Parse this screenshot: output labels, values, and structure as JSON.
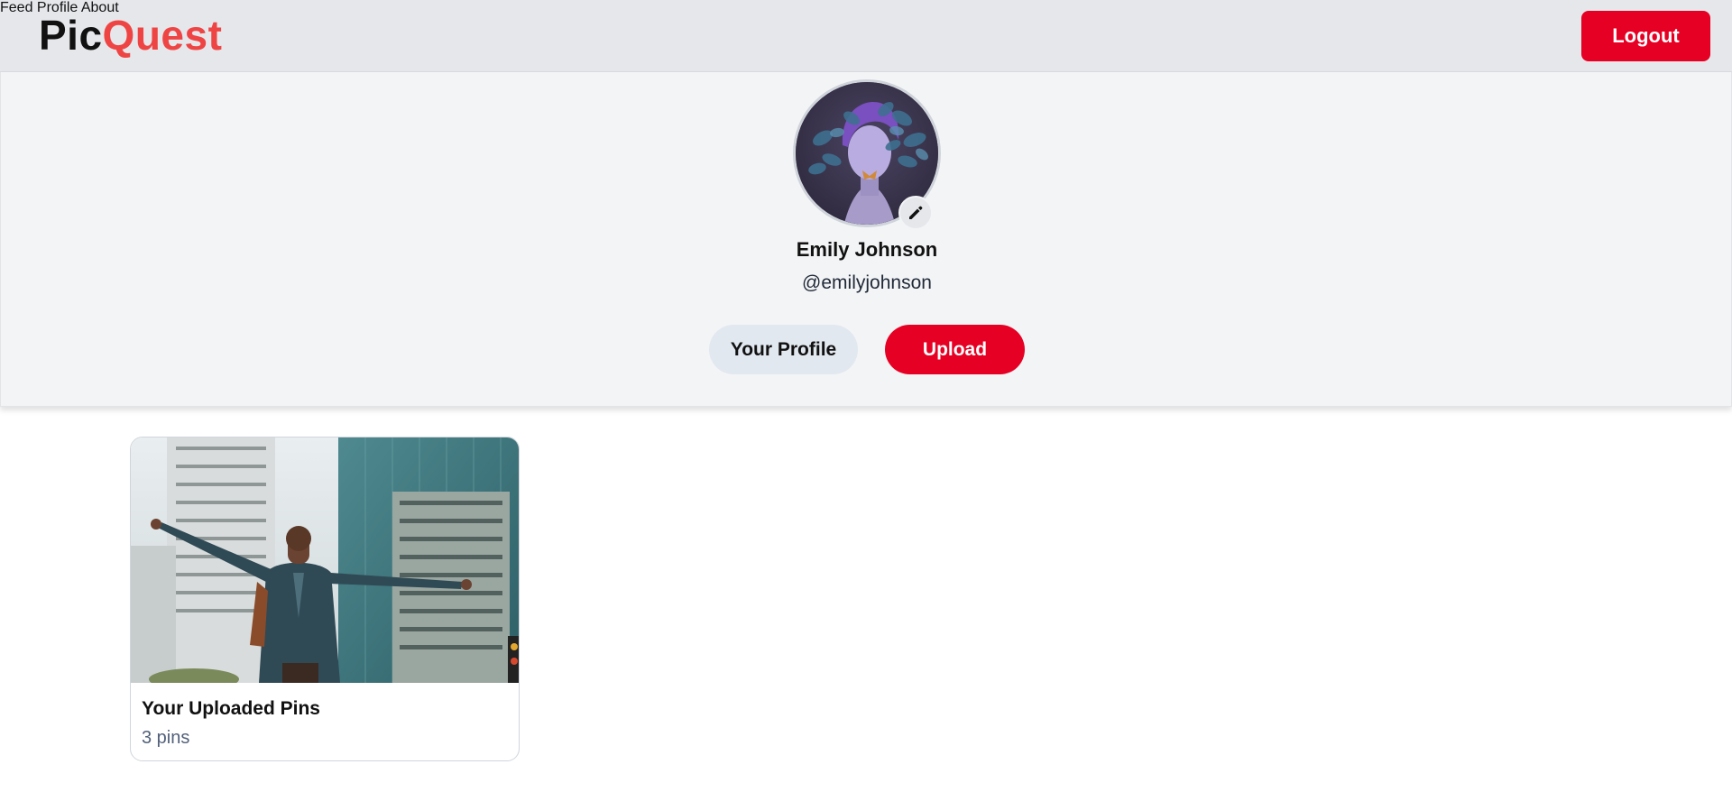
{
  "header": {
    "logo_part1": "Pic",
    "logo_part2": "Quest",
    "nav": [
      {
        "label": "Feed"
      },
      {
        "label": "Profile"
      },
      {
        "label": "About"
      }
    ],
    "logout_label": "Logout"
  },
  "profile": {
    "full_name": "Emily Johnson",
    "username": "@emilyjohnson",
    "your_profile_label": "Your Profile",
    "upload_label": "Upload",
    "avatar_icon": "avatar-illustration",
    "edit_icon": "pencil-icon"
  },
  "boards": [
    {
      "title": "Your Uploaded Pins",
      "count": "3 pins"
    }
  ],
  "colors": {
    "accent": "#e60023",
    "logo_accent": "#ef4444",
    "header_bg": "#e5e7eb",
    "panel_bg": "#f3f4f6",
    "secondary_button": "#e2e8f0"
  }
}
